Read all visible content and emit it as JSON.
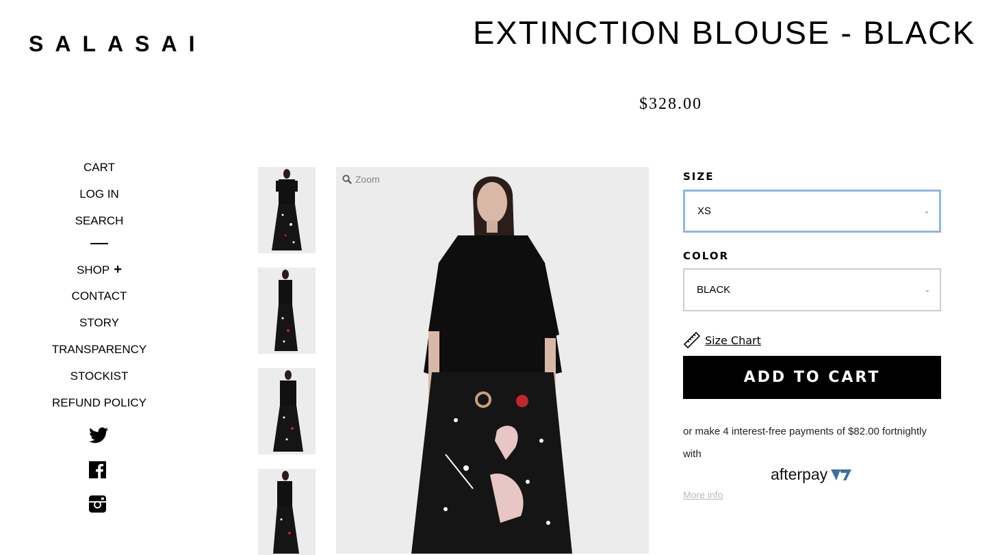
{
  "brand": {
    "logo": "SALASAI"
  },
  "product": {
    "title": "EXTINCTION BLOUSE - BLACK",
    "price": "$328.00"
  },
  "nav": {
    "items": [
      {
        "label": "CART"
      },
      {
        "label": "LOG IN"
      },
      {
        "label": "SEARCH"
      }
    ],
    "items2": [
      {
        "label": "SHOP"
      },
      {
        "label": "CONTACT"
      },
      {
        "label": "STORY"
      },
      {
        "label": "TRANSPARENCY"
      },
      {
        "label": "STOCKIST"
      },
      {
        "label": "REFUND POLICY"
      }
    ],
    "shop_expand_icon": "plus-icon"
  },
  "social": [
    "twitter-icon",
    "facebook-icon",
    "instagram-icon"
  ],
  "gallery": {
    "zoom_label": "Zoom",
    "thumbnail_count": 4
  },
  "options": {
    "size_label": "SIZE",
    "size_value": "XS",
    "color_label": "COLOR",
    "color_value": "BLACK"
  },
  "size_chart_label": "Size Chart",
  "add_to_cart_label": "ADD TO CART",
  "afterpay": {
    "text": "or make 4 interest-free payments of $82.00 fortnightly with",
    "logo_text": "afterpay",
    "more_info": "More info"
  },
  "colors": {
    "accent_focus": "#8fb3e8",
    "button_bg": "#000000",
    "afterpay_blue": "#3a6ea5"
  }
}
